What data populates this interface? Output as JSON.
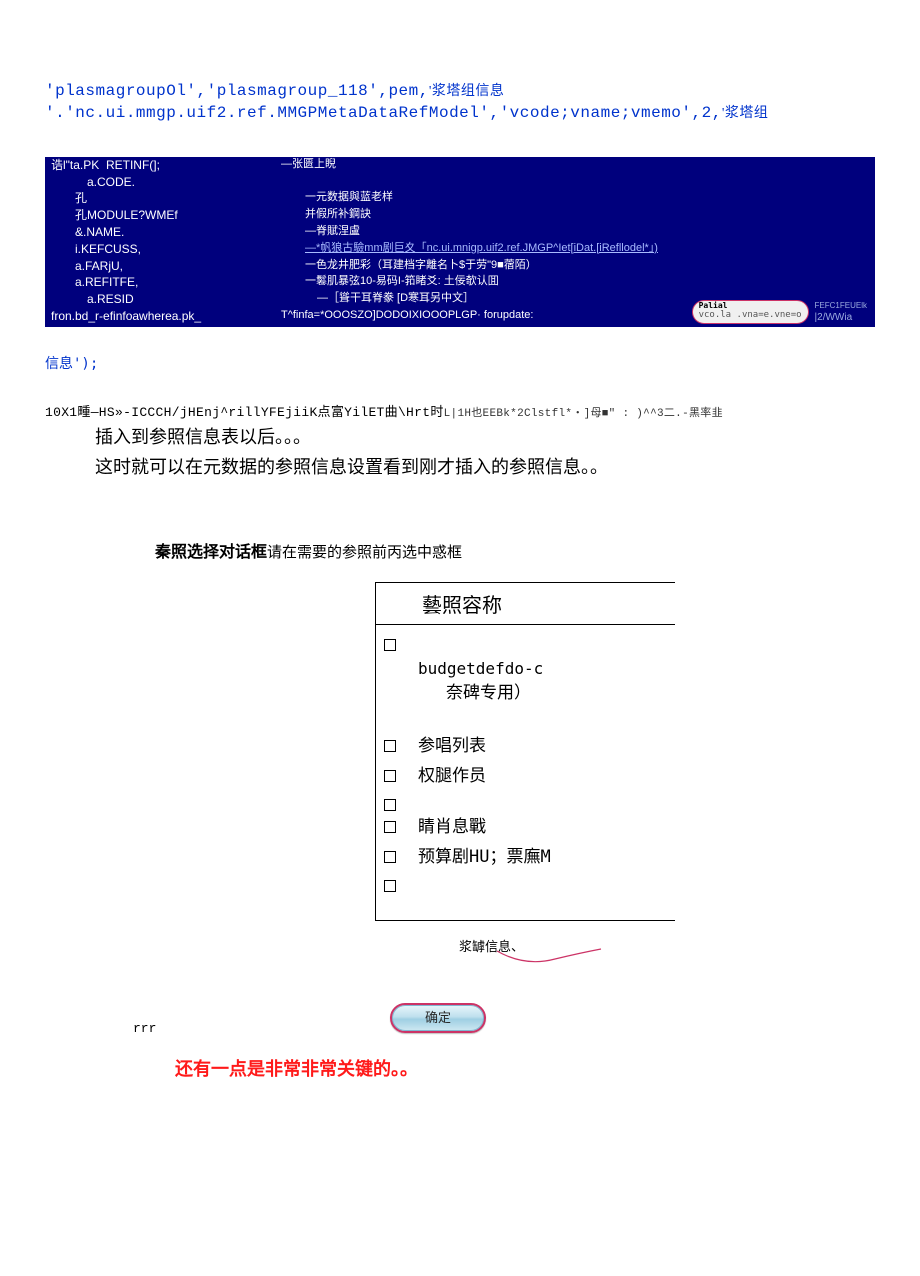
{
  "code_top": {
    "frag1": "'plasmagroupOl','plasmagroup_118',pem,",
    "frag1_zh": "'浆塔组信息",
    "frag2_prefix": "'.",
    "frag2": "'nc.ui.mmgp.uif2.ref.MMGPMetaDataRefModel','vcode;vname;vmemo',2,",
    "frag2_zh": "'浆塔组"
  },
  "blue_panel": {
    "left": [
      "诰l\"ta.PK  RETINF(];",
      "a.CODE.",
      "孔",
      "孔MODULE?WMEf",
      "&.NAME.",
      "i.KEFCUSS,",
      "a.FARjU,",
      "a.REFITFE,",
      "a.RESID",
      "fron.bd_r-efinfoawherea.pk_"
    ],
    "right": [
      "—张匮上睨",
      "",
      "一元数据與蓝老样",
      "并假所补鋼訣",
      "—脊賦涅盧",
      "—*帆狼古驗mm剧巨夊「nc.ui.mnigp.uif2.ref.JMGP^Iet[iDat.[iRefllodel*」)",
      "一色龙井肥彩（耳建档字離名卜$于劳\"9■蓿陌）",
      "一鬈肌暴弦10-易码I-筘睹爻: 土佞欹认囬",
      "—［聳干耳脊豢 [D寒耳另中文］",
      "T^finfa=*OOOSZO]DODOIXIOOOPLGP· forupdate:"
    ],
    "corner_pill_top": "Palial",
    "corner_pill_bot": "vco.la .vna=e.vne=o",
    "corner_right1": "|2/WWia",
    "corner_right2": "FEFC1FEUElk"
  },
  "post_blue": "信息');",
  "garble": {
    "main": "10X1畽—HS»-ICCCH/jHEnj^rillYFEjiiK点富YilET曲\\Hrt时",
    "tail": "L|1H也EEBk*2Clstfl*・]母■\" : )^^3二.-黑率韭"
  },
  "body": {
    "p1": "插入到参照信息表以后。。。",
    "p2": "这时就可以在元数据的参照信息设置看到刚才插入的参照信息。。"
  },
  "dialog": {
    "title_bold": "秦照选择对话框",
    "title_rest": "请在需要的参照前丙选中惑框",
    "header": "藝照容称",
    "items": [
      {
        "label": "budgetdefdo-c",
        "sub": "奈碑专用）"
      },
      {
        "label": "参唱列表"
      },
      {
        "label": "权腿作员"
      },
      {
        "label": ""
      },
      {
        "label": "睛肖息戰"
      },
      {
        "label": "预算剧HU；票廡M"
      },
      {
        "label": ""
      }
    ],
    "annot": "浆罅信息、"
  },
  "ok_row": {
    "rrr": "rrr",
    "ok": "确定"
  },
  "red": "还有一点是非常非常关键的。。"
}
